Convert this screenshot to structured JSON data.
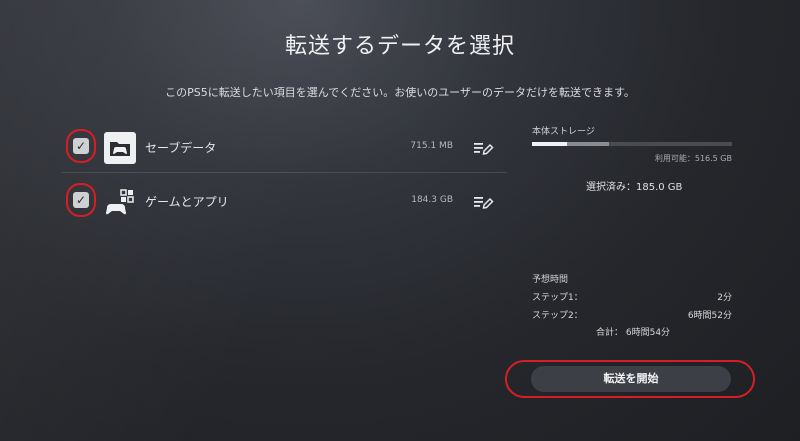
{
  "header": {
    "title": "転送するデータを選択",
    "subtitle": "このPS5に転送したい項目を選んでください。お使いのユーザーのデータだけを転送できます。"
  },
  "items": [
    {
      "label": "セーブデータ",
      "size": "715.1 MB",
      "checked": true,
      "icon": "save-data-folder-icon"
    },
    {
      "label": "ゲームとアプリ",
      "size": "184.3 GB",
      "checked": true,
      "icon": "games-and-apps-icon"
    }
  ],
  "storage": {
    "title": "本体ストレージ",
    "available": "利用可能：516.5 GB",
    "selected": "選択済み：185.0 GB"
  },
  "estimate": {
    "title": "予想時間",
    "step1_label": "ステップ1：",
    "step1_value": "2分",
    "step2_label": "ステップ2：",
    "step2_value": "6時間52分",
    "total": "合計： 6時間54分"
  },
  "start_button": "転送を開始",
  "colors": {
    "highlight": "#d81e25",
    "background": "#25272c"
  }
}
